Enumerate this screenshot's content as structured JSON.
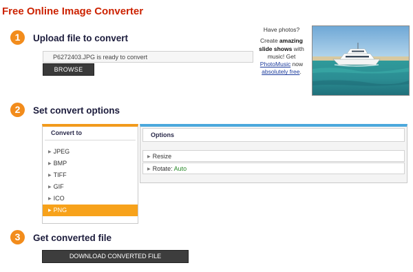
{
  "app": {
    "title": "Free Online Image Converter"
  },
  "steps": [
    {
      "number": "1",
      "title": "Upload file to convert"
    },
    {
      "number": "2",
      "title": "Set convert options"
    },
    {
      "number": "3",
      "title": "Get converted file"
    }
  ],
  "upload": {
    "status_text": "P6272403.JPG is ready to convert",
    "browse_label": "BROWSE"
  },
  "promo": {
    "line1": "Have photos?",
    "line2_pre": "Create ",
    "line2_bold": "amazing",
    "line3_bold": "slide shows",
    "line3_post": " with",
    "line4": "music! Get",
    "link1": "PhotoMusic",
    "line5_post": " now",
    "link2": "absolutely free",
    "line6_post": ".",
    "image_icon": "boat-photo"
  },
  "convert_to": {
    "header": "Convert to",
    "formats": [
      "JPEG",
      "BMP",
      "TIFF",
      "GIF",
      "ICO",
      "PNG"
    ],
    "selected": "PNG"
  },
  "options": {
    "header": "Options",
    "resize_label": "Resize",
    "rotate_label": "Rotate: ",
    "rotate_value": "Auto"
  },
  "download": {
    "label": "DOWNLOAD CONVERTED FILE"
  },
  "colors": {
    "title_red": "#cc2200",
    "step_orange": "#f28c1c",
    "selected_orange": "#f7a21b",
    "options_blue": "#4ba8dc",
    "button_dark": "#3a3a3a"
  }
}
